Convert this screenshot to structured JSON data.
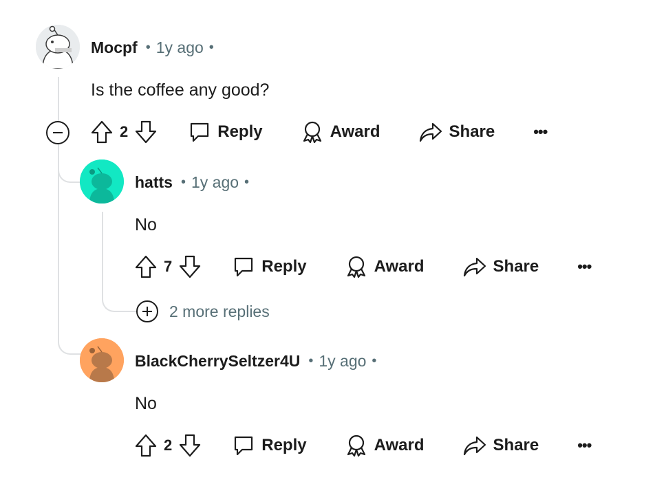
{
  "comments": [
    {
      "username": "Mocpf",
      "time": "1y ago",
      "body": "Is the coffee any good?",
      "votes": "2",
      "avatar_color": "#e4e8ea",
      "actions": {
        "reply": "Reply",
        "award": "Award",
        "share": "Share",
        "more": "•••"
      }
    },
    {
      "username": "hatts",
      "time": "1y ago",
      "body": "No",
      "votes": "7",
      "avatar_color": "#12e8c3",
      "actions": {
        "reply": "Reply",
        "award": "Award",
        "share": "Share",
        "more": "•••"
      },
      "more_replies": "2 more replies"
    },
    {
      "username": "BlackCherrySeltzer4U",
      "time": "1y ago",
      "body": "No",
      "votes": "2",
      "avatar_color": "#ffa35f",
      "actions": {
        "reply": "Reply",
        "award": "Award",
        "share": "Share",
        "more": "•••"
      }
    }
  ],
  "separator": "•"
}
